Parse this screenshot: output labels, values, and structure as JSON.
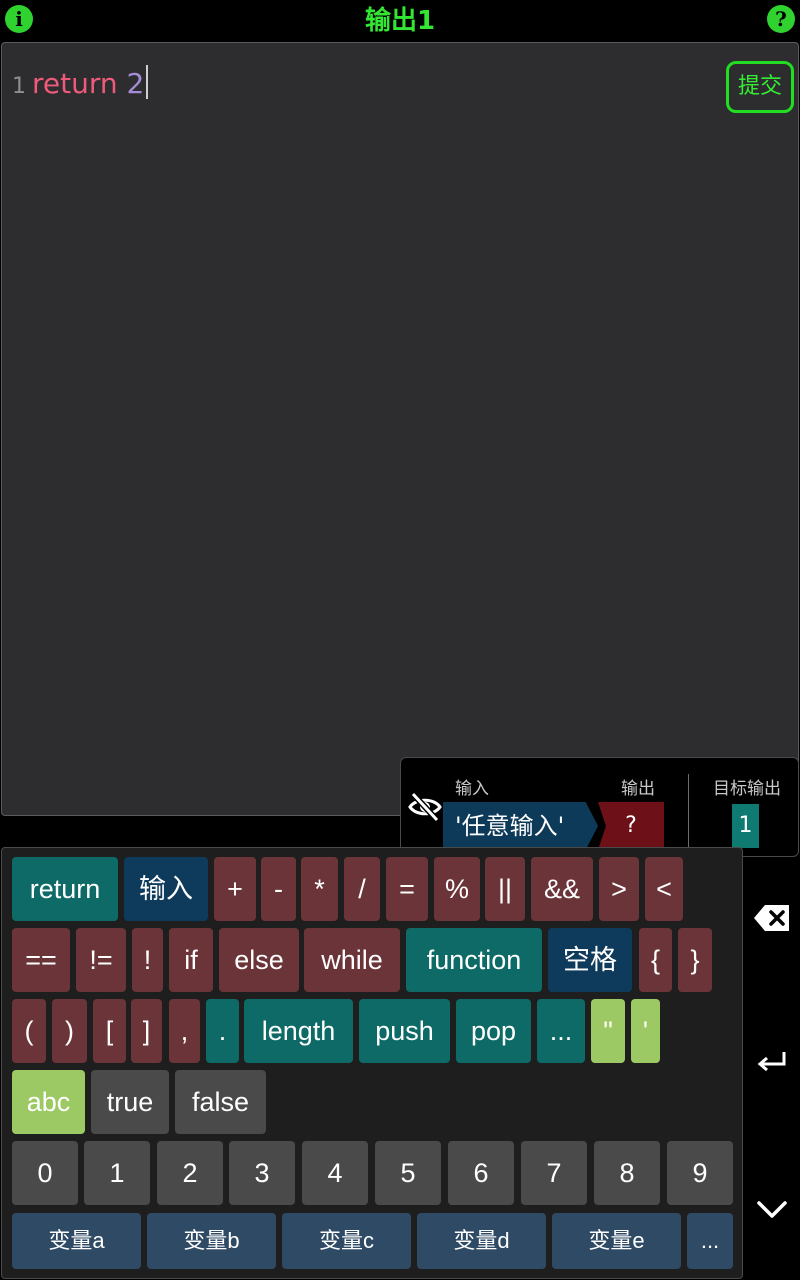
{
  "header": {
    "title": "输出1",
    "info_icon_glyph": "i",
    "help_icon_glyph": "?"
  },
  "editor": {
    "line_number": "1",
    "keyword": "return",
    "value": "2",
    "submit_label": "提交"
  },
  "io": {
    "input_label": "输入",
    "output_label": "输出",
    "target_label": "目标输出",
    "input_value": "'任意输入'",
    "output_value": "?",
    "target_value": "1"
  },
  "keyboard": {
    "row1": [
      "return",
      "输入",
      "+",
      "-",
      "*",
      "/",
      "=",
      "%",
      "||",
      "&&",
      ">",
      "<"
    ],
    "row2": [
      "==",
      "!=",
      "!",
      "if",
      "else",
      "while",
      "function",
      "空格",
      "{",
      "}"
    ],
    "row3": [
      "(",
      ")",
      "[",
      "]",
      ",",
      ".",
      "length",
      "push",
      "pop",
      "...",
      "\"",
      "'"
    ],
    "row4": [
      "abc",
      "true",
      "false"
    ],
    "digits": [
      "0",
      "1",
      "2",
      "3",
      "4",
      "5",
      "6",
      "7",
      "8",
      "9"
    ],
    "vars": [
      "变量a",
      "变量b",
      "变量c",
      "变量d",
      "变量e",
      "..."
    ]
  },
  "side_icons": [
    "backspace-icon",
    "enter-icon",
    "collapse-icon"
  ],
  "colors": {
    "accent_green": "#33e633",
    "key_teal": "#0e6a66",
    "key_blue": "#0e3a5c",
    "key_red": "#6b3438",
    "key_lime": "#9cc964",
    "key_gray": "#4a4a4a"
  }
}
